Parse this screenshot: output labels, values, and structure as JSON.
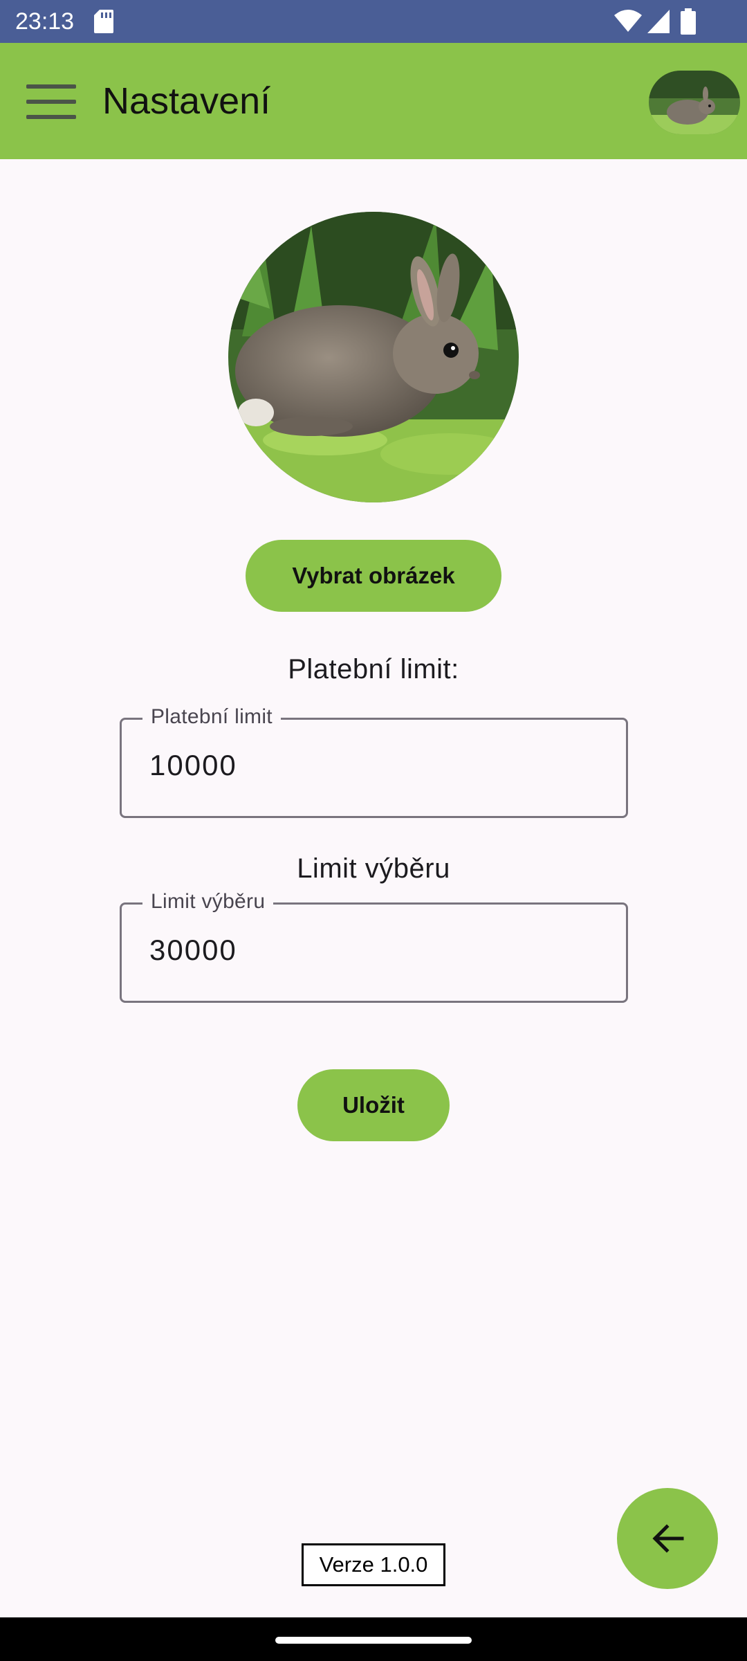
{
  "status_bar": {
    "time": "23:13",
    "icons": [
      "sd-card-icon",
      "wifi-icon",
      "cell-signal-icon",
      "battery-icon"
    ],
    "background": "#4a5e96"
  },
  "app_bar": {
    "title": "Nastavení",
    "menu_icon": "menu-icon",
    "avatar": "rabbit-avatar",
    "background": "#8bc34a"
  },
  "profile": {
    "image": "rabbit-photo",
    "pick_image_label": "Vybrat obrázek"
  },
  "payment_limit": {
    "heading": "Platební limit:",
    "field_label": "Platební limit",
    "value": "10000"
  },
  "withdrawal_limit": {
    "heading": "Limit výběru",
    "field_label": "Limit výběru",
    "value": "30000"
  },
  "save_label": "Uložit",
  "version": "Verze 1.0.0",
  "fab_icon": "arrow-back-icon",
  "accent": "#8bc34a"
}
